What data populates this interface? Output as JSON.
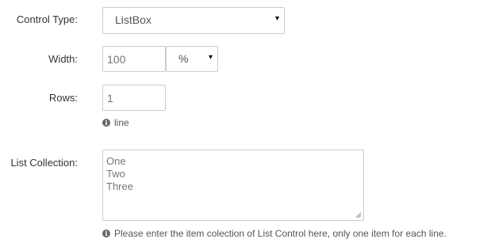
{
  "form": {
    "control_type": {
      "label": "Control Type:",
      "value": "ListBox",
      "caret": "▾"
    },
    "width": {
      "label": "Width:",
      "value": "100",
      "unit": "%",
      "caret": "▾"
    },
    "rows": {
      "label": "Rows:",
      "value": "1",
      "help_icon": "i",
      "help_text": "line"
    },
    "list_collection": {
      "label": "List Collection:",
      "items": [
        "One",
        "Two",
        "Three"
      ],
      "help_icon": "i",
      "help_text": "Please enter the item colection of List Control here, only one item for each line."
    }
  },
  "icons": {
    "info": "info-circle-icon",
    "caret": "caret-down-icon",
    "resize": "resize-grip-icon"
  }
}
